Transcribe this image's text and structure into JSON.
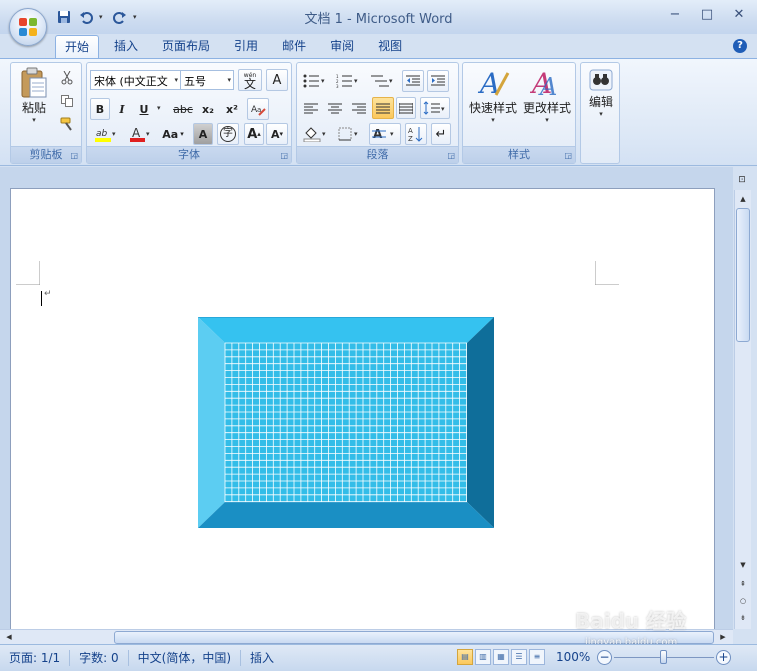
{
  "window": {
    "title": "文档 1 - Microsoft Word",
    "controls": {
      "minimize": "−",
      "maximize": "□",
      "close": "✕"
    }
  },
  "qat": {
    "dropdown": "▾"
  },
  "tabs": [
    {
      "label": "开始",
      "active": true
    },
    {
      "label": "插入"
    },
    {
      "label": "页面布局"
    },
    {
      "label": "引用"
    },
    {
      "label": "邮件"
    },
    {
      "label": "审阅"
    },
    {
      "label": "视图"
    }
  ],
  "ribbon": {
    "clipboard": {
      "label": "剪贴板",
      "paste": "粘贴"
    },
    "font": {
      "label": "字体",
      "font_name": "宋体 (中文正文",
      "font_size": "五号",
      "wen": "wén\n文",
      "bold": "B",
      "italic": "I",
      "underline": "U",
      "strike": "abc",
      "subscript": "x₂",
      "superscript": "x²",
      "text_effect": "A",
      "font_case": "Aa",
      "grow": "A",
      "shrink": "A",
      "char_border": "A",
      "enclose": "字"
    },
    "paragraph": {
      "label": "段落"
    },
    "styles": {
      "label": "样式",
      "quick_styles": "快速样式",
      "change_styles": "更改样式"
    },
    "editing": {
      "label": "编辑"
    }
  },
  "statusbar": {
    "page": "页面: 1/1",
    "words": "字数: 0",
    "language": "中文(简体，中国)",
    "mode": "插入",
    "zoom": "100%"
  },
  "watermark": {
    "text": "Baidu 经验",
    "sub": "jingyan.baidu.com"
  },
  "colors": {
    "shape_fill": "#33bde8",
    "shape_top": "#35c2f0",
    "shape_left": "#5ccdf2",
    "shape_bottom": "#1a8fc4",
    "shape_right": "#0f6e9a",
    "grid_line": "#ffffff"
  }
}
